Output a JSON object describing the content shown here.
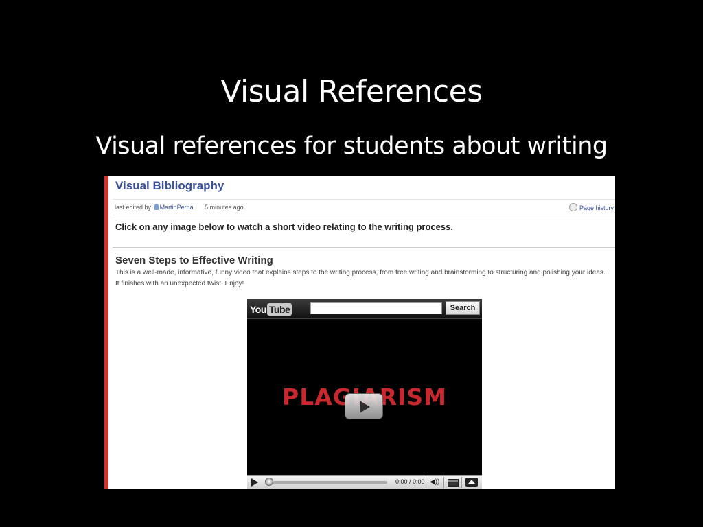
{
  "slide": {
    "title": "Visual References",
    "subtitle": "Visual references for students about writing"
  },
  "wiki": {
    "page_title": "Visual Bibliography",
    "meta": {
      "edited_prefix": "last edited by",
      "user": "MartinPerna",
      "time": "5 minutes ago",
      "history_link": "Page history"
    },
    "instruction": "Click on any image below to watch a short video relating to the writing process.",
    "section": {
      "heading": "Seven Steps to Effective Writing",
      "description": "This is a well-made, informative, funny video that explains steps to the writing process, from free writing and brainstorming to structuring and polishing your ideas. It finishes with an unexpected twist. Enjoy!"
    }
  },
  "player": {
    "logo_you": "You",
    "logo_tube": "Tube",
    "search_value": "",
    "search_button": "Search",
    "video_title": "PLAGIARISM",
    "time": "0:00 / 0:00",
    "progress": 0,
    "icons": [
      "play-icon",
      "volume-icon",
      "screen-size-icon",
      "expand-icon"
    ]
  },
  "colors": {
    "slide_background": "#000000",
    "wiki_title": "#3a4f9a",
    "accent_border": "#c8332e",
    "video_title": "#c7272d"
  }
}
